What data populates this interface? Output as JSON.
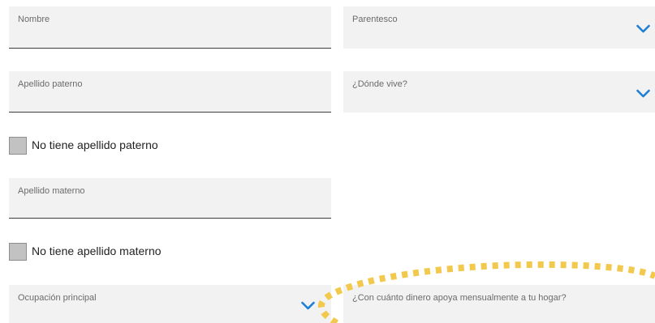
{
  "fields": {
    "nombre": {
      "label": "Nombre"
    },
    "parentesco": {
      "label": "Parentesco"
    },
    "apellido_paterno": {
      "label": "Apellido paterno"
    },
    "donde_vive": {
      "label": "¿Dónde vive?"
    },
    "apellido_materno": {
      "label": "Apellido materno"
    },
    "ocupacion": {
      "label": "Ocupación principal"
    },
    "dinero_apoyo": {
      "label": "¿Con cuánto dinero apoya mensualmente a tu hogar?"
    }
  },
  "checkboxes": {
    "sin_paterno": {
      "label": "No tiene apellido paterno",
      "checked": false
    },
    "sin_materno": {
      "label": "No tiene apellido materno",
      "checked": false
    }
  },
  "icons": {
    "dropdown": "chevron-down-icon",
    "highlight": "dotted-highlight-ring"
  },
  "colors": {
    "chevron": "#1e7fd6",
    "field_bg": "#f2f2f2",
    "highlight": "#f2c94c"
  }
}
